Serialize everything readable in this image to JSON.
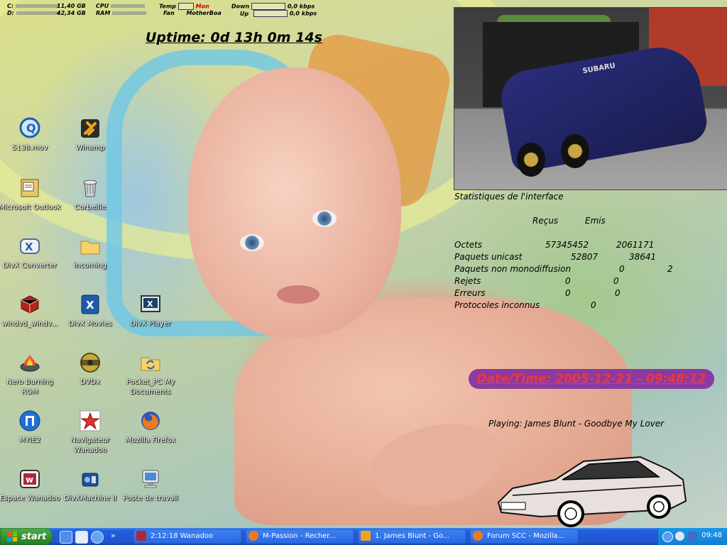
{
  "system_monitor": {
    "drive_c_label": "C:",
    "drive_c_value": "11,40 GB",
    "drive_d_label": "D:",
    "drive_d_value": "42,34 GB",
    "cpu_label": "CPU",
    "ram_label": "RAM",
    "temp_label": "Temp",
    "temp_value": "Mon",
    "fan_label": "Fan",
    "fan_value": "MotherBoa",
    "down_label": "Down",
    "down_value": "0,0 kbps",
    "up_label": "Up",
    "up_value": "0,0 kbps"
  },
  "uptime": "Uptime: 0d 13h 0m 14s",
  "interface_stats": {
    "title": "Statistiques de l'interface",
    "col_received": "Reçus",
    "col_sent": "Emis",
    "rows": [
      {
        "label": "Octets",
        "received": "57345452",
        "sent": "2061171"
      },
      {
        "label": "Paquets unicast",
        "received": "52807",
        "sent": "38641"
      },
      {
        "label": "Paquets non monodiffusion",
        "received": "0",
        "sent": "2"
      },
      {
        "label": "Rejets",
        "received": "0",
        "sent": "0"
      },
      {
        "label": "Erreurs",
        "received": "0",
        "sent": "0"
      },
      {
        "label": "Protocoles inconnus",
        "received": "0",
        "sent": ""
      }
    ]
  },
  "datetime": "Date/Time: 2005-12-21 - 09:48:12",
  "now_playing": "Playing: James Blunt - Goodbye My Lover",
  "photo_text": "SUBARU",
  "desktop_icons": [
    {
      "label": "5138.mov",
      "icon": "quicktime-icon"
    },
    {
      "label": "Winamp",
      "icon": "winamp-icon"
    },
    {
      "label": "Microsoft Outlook",
      "icon": "outlook-icon"
    },
    {
      "label": "Corbeille",
      "icon": "recycle-bin-icon"
    },
    {
      "label": "DivX Converter",
      "icon": "divx-converter-icon"
    },
    {
      "label": "incoming",
      "icon": "folder-icon"
    },
    {
      "label": "windvd_windv...",
      "icon": "windvd-icon"
    },
    {
      "label": "DivX Movies",
      "icon": "divx-movies-icon"
    },
    {
      "label": "DivX Player",
      "icon": "divx-player-icon"
    },
    {
      "label": "Nero Burning ROM",
      "icon": "nero-icon"
    },
    {
      "label": "DVDx",
      "icon": "dvdx-icon"
    },
    {
      "label": "Pocket_PC My Documents",
      "icon": "sync-folder-icon"
    },
    {
      "label": "MYIE2",
      "icon": "myie2-icon"
    },
    {
      "label": "Navigateur Wanadoo",
      "icon": "wanadoo-browser-icon"
    },
    {
      "label": "Mozilla Firefox",
      "icon": "firefox-icon"
    },
    {
      "label": "Espace Wanadoo",
      "icon": "espace-wanadoo-icon"
    },
    {
      "label": "DivXMachine II",
      "icon": "divxmachine-icon"
    },
    {
      "label": "Poste de travail",
      "icon": "my-computer-icon"
    }
  ],
  "taskbar": {
    "start_label": "start",
    "tasks": [
      {
        "label": "2:12:18 Wanadoo",
        "icon": "wanadoo-icon"
      },
      {
        "label": "M-Passion - Recher...",
        "icon": "firefox-icon"
      },
      {
        "label": "1. James Blunt - Go...",
        "icon": "winamp-icon"
      },
      {
        "label": "Forum SCC - Mozilla...",
        "icon": "firefox-icon"
      }
    ],
    "clock": "09:48"
  },
  "colors": {
    "taskbar_blue": "#245edb",
    "start_green": "#2f8e2f",
    "datetime_bg": "#8a3aa2",
    "datetime_text": "#f13737"
  }
}
